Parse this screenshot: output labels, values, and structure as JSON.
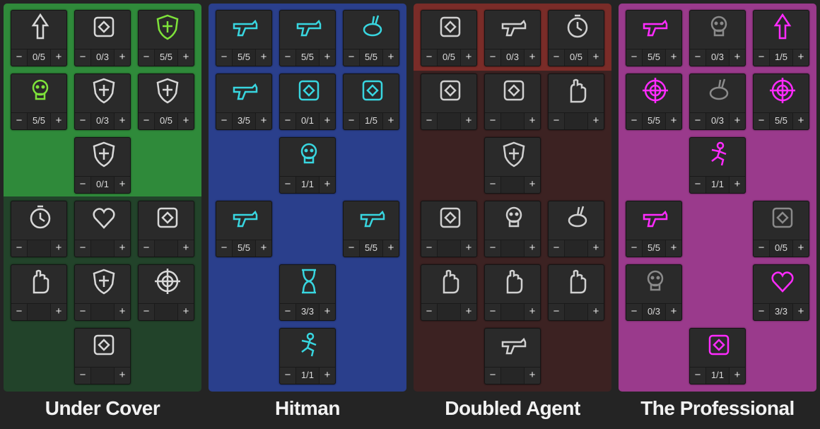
{
  "trees": [
    {
      "name": "Under Cover",
      "colors": {
        "top": "#2f8a3a",
        "bottom": "#22432a",
        "icon": "#d8d8d8",
        "active_icon": "#7ee23a"
      },
      "skills": [
        {
          "icon": "armor-up-arrow-icon",
          "value": "0/5"
        },
        {
          "icon": "dna-cross-icon",
          "value": "0/3"
        },
        {
          "icon": "hourglass-shield-icon",
          "value": "5/5",
          "active": true
        },
        {
          "icon": "skull-burst-icon",
          "value": "5/5",
          "active": true
        },
        {
          "icon": "patched-shield-icon",
          "value": "0/3"
        },
        {
          "icon": "shield-cross-icon",
          "value": "0/5"
        },
        {
          "icon": "shield-helmet-icon",
          "value": "0/1"
        },
        {
          "icon": "stopwatch-lightning-icon",
          "value": ""
        },
        {
          "icon": "heart-ice-icon",
          "value": ""
        },
        {
          "icon": "spray-can-icon",
          "value": ""
        },
        {
          "icon": "frozen-fist-icon",
          "value": ""
        },
        {
          "icon": "spiral-shield-icon",
          "value": ""
        },
        {
          "icon": "crosshair-target-icon",
          "value": ""
        },
        {
          "icon": "armored-vest-icon",
          "value": ""
        }
      ]
    },
    {
      "name": "Hitman",
      "colors": {
        "top": "#2a3f8c",
        "bottom": "#2a3f8c",
        "icon": "#38d6e0",
        "active_icon": "#38d6e0"
      },
      "skills": [
        {
          "icon": "shotgun-shells-icon",
          "value": "5/5"
        },
        {
          "icon": "rotating-gun-icon",
          "value": "5/5"
        },
        {
          "icon": "rabbit-burst-icon",
          "value": "5/5"
        },
        {
          "icon": "ammo-crate-icon",
          "value": "3/5"
        },
        {
          "icon": "grenade-blast-icon",
          "value": "0/1"
        },
        {
          "icon": "fanged-mouth-icon",
          "value": "1/5"
        },
        {
          "icon": "skull-pedestal-icon",
          "value": "1/1"
        },
        {
          "icon": "bullets-spray-icon",
          "value": "5/5"
        },
        {
          "icon": "bullet-impact-icon",
          "value": "5/5"
        },
        {
          "icon": "hourglass-burst-icon",
          "value": "3/3"
        },
        {
          "icon": "reaper-ghost-icon",
          "value": "1/1"
        }
      ]
    },
    {
      "name": "Doubled Agent",
      "colors": {
        "top": "#7a2c28",
        "bottom": "#3c2222",
        "icon": "#d0d0d0",
        "active_icon": "#d0d0d0"
      },
      "skills": [
        {
          "icon": "megaphone-icon",
          "value": "0/5"
        },
        {
          "icon": "magazine-icon",
          "value": "0/3"
        },
        {
          "icon": "alarm-clock-icon",
          "value": "0/5"
        },
        {
          "icon": "chest-armor-icon",
          "value": ""
        },
        {
          "icon": "brain-helmet-icon",
          "value": ""
        },
        {
          "icon": "fist-bandage-icon",
          "value": ""
        },
        {
          "icon": "shield-dagger-icon",
          "value": ""
        },
        {
          "icon": "basket-icon",
          "value": ""
        },
        {
          "icon": "skull-crossed-swords-icon",
          "value": ""
        },
        {
          "icon": "running-rabbit-icon",
          "value": ""
        },
        {
          "icon": "open-hand-icon",
          "value": ""
        },
        {
          "icon": "muscle-torso-icon",
          "value": ""
        },
        {
          "icon": "sparkling-hands-icon",
          "value": ""
        },
        {
          "icon": "revolver-icon",
          "value": ""
        }
      ]
    },
    {
      "name": "The Professional",
      "colors": {
        "top": "#9a3a8c",
        "bottom": "#9a3a8c",
        "icon": "#ff2bff",
        "active_icon": "#ff2bff"
      },
      "skills": [
        {
          "icon": "gun-explosion-icon",
          "value": "5/5"
        },
        {
          "icon": "skull-crossbones-icon",
          "value": "0/3",
          "dim": true
        },
        {
          "icon": "rocket-boot-icon",
          "value": "1/5"
        },
        {
          "icon": "crosshair-scope-icon",
          "value": "5/5"
        },
        {
          "icon": "winged-boar-icon",
          "value": "0/3",
          "dim": true
        },
        {
          "icon": "target-arrow-up-icon",
          "value": "5/5"
        },
        {
          "icon": "sprinting-man-icon",
          "value": "1/1"
        },
        {
          "icon": "ammo-case-icon",
          "value": "5/5"
        },
        {
          "icon": "gear-cube-icon",
          "value": "0/5",
          "dim": true
        },
        {
          "icon": "skull-compass-icon",
          "value": "0/3",
          "dim": true
        },
        {
          "icon": "piercing-heart-icon",
          "value": "3/3"
        },
        {
          "icon": "lightning-grenade-icon",
          "value": "1/1"
        }
      ]
    }
  ],
  "controls": {
    "minus": "−",
    "plus": "+"
  }
}
